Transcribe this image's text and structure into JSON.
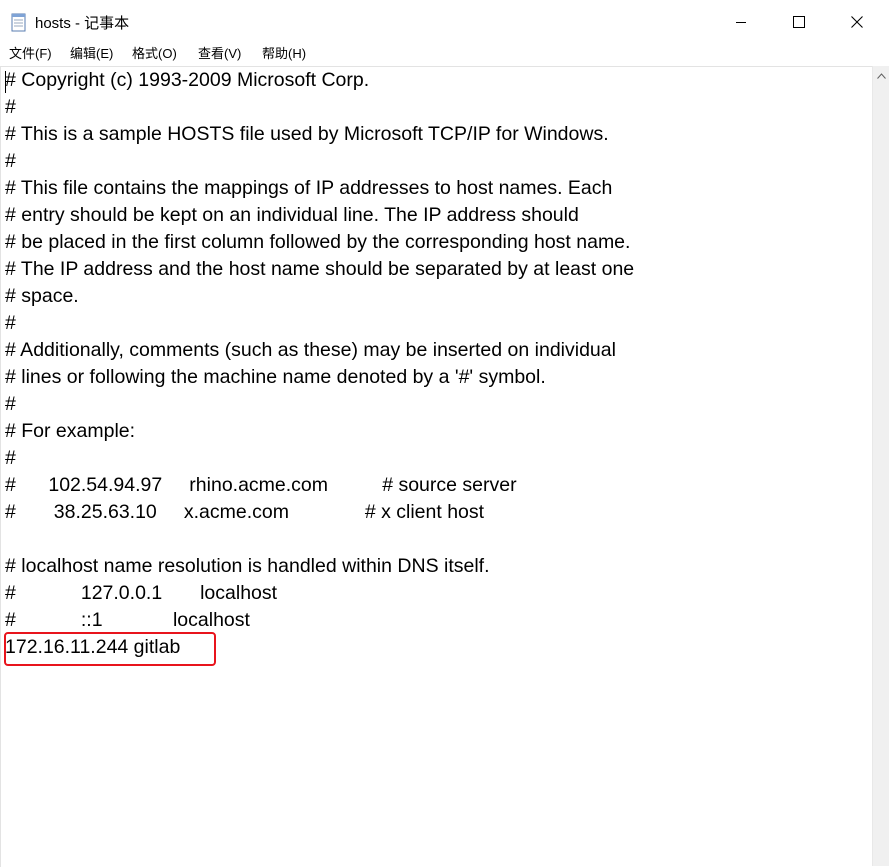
{
  "window": {
    "title": "hosts - 记事本",
    "icon": "notepad-icon",
    "controls": {
      "minimize": "minimize-icon",
      "maximize": "maximize-icon",
      "close": "close-icon"
    }
  },
  "menu": [
    {
      "label": "文件(F)"
    },
    {
      "label": "编辑(E)"
    },
    {
      "label": "格式(O)"
    },
    {
      "label": "查看(V)"
    },
    {
      "label": "帮助(H)"
    }
  ],
  "editor": {
    "lines": [
      "# Copyright (c) 1993-2009 Microsoft Corp.",
      "#",
      "# This is a sample HOSTS file used by Microsoft TCP/IP for Windows.",
      "#",
      "# This file contains the mappings of IP addresses to host names. Each",
      "# entry should be kept on an individual line. The IP address should",
      "# be placed in the first column followed by the corresponding host name.",
      "# The IP address and the host name should be separated by at least one",
      "# space.",
      "#",
      "# Additionally, comments (such as these) may be inserted on individual",
      "# lines or following the machine name denoted by a '#' symbol.",
      "#",
      "# For example:",
      "#",
      "#      102.54.94.97     rhino.acme.com          # source server",
      "#       38.25.63.10     x.acme.com              # x client host",
      "",
      "# localhost name resolution is handled within DNS itself.",
      "#            127.0.0.1       localhost",
      "#            ::1             localhost",
      "172.16.11.244 gitlab"
    ]
  },
  "colors": {
    "highlight_border": "#e8141c"
  }
}
